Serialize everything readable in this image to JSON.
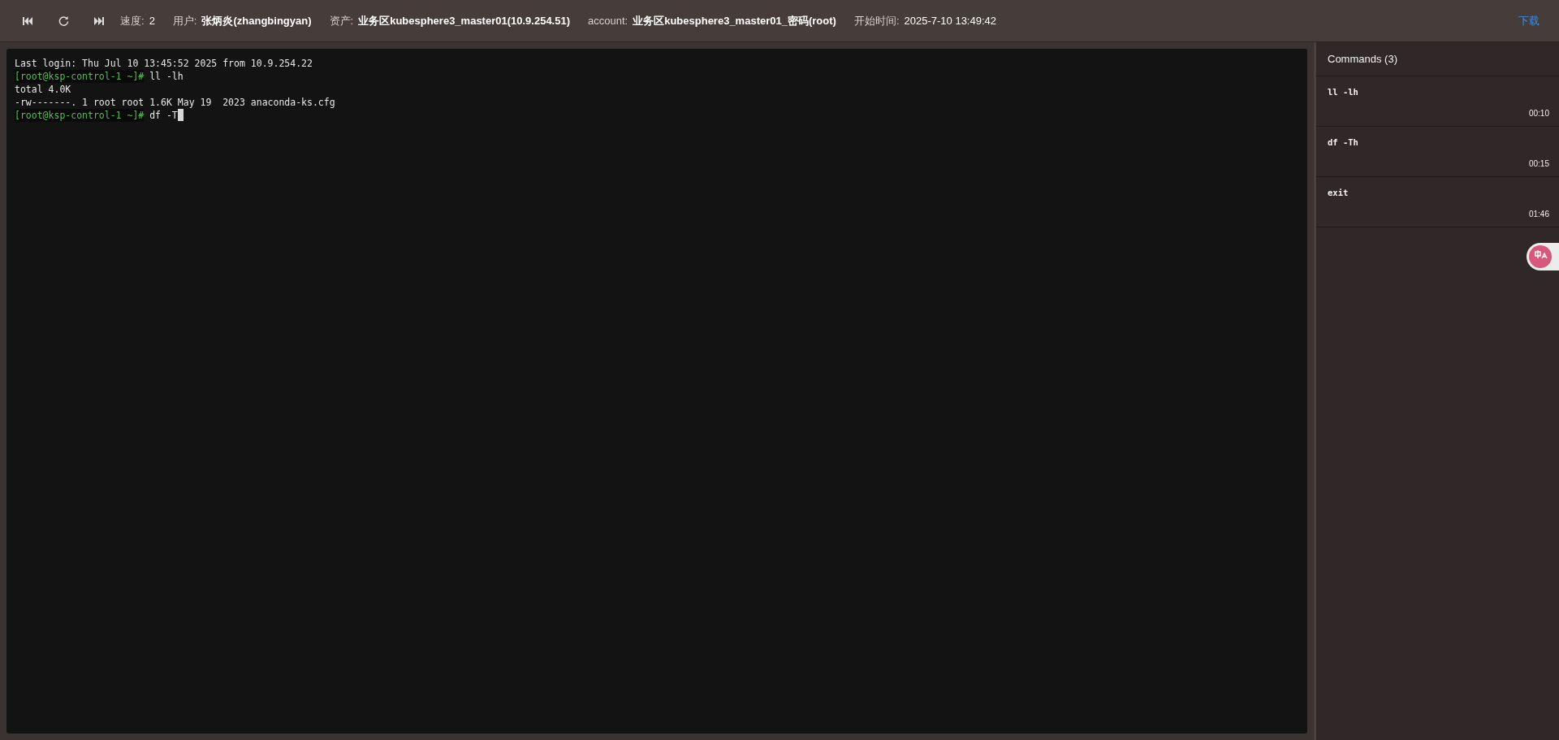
{
  "toolbar": {
    "controls": [
      {
        "kind": "skip-back"
      },
      {
        "kind": "replay"
      },
      {
        "kind": "skip-forward"
      }
    ],
    "info": [
      {
        "label": "速度:",
        "value": "2",
        "bold": false
      },
      {
        "label": "用户:",
        "value": "张炳炎(zhangbingyan)",
        "bold": true
      },
      {
        "label": "资产:",
        "value": "业务区kubesphere3_master01(10.9.254.51)",
        "bold": true
      },
      {
        "label": "account:",
        "value": "业务区kubesphere3_master01_密码(root)",
        "bold": true
      },
      {
        "label": "开始时间:",
        "value": "2025-7-10 13:49:42",
        "bold": false
      }
    ],
    "download": "下载"
  },
  "terminal": {
    "cursor": true,
    "lines": [
      [
        {
          "kind": "output",
          "text": "Last login: Thu Jul 10 13:45:52 2025 from 10.9.254.22"
        }
      ],
      [
        {
          "kind": "prompt",
          "text": "[root@ksp-control-1 ~]#"
        },
        {
          "kind": "output",
          "text": " ll -lh"
        }
      ],
      [
        {
          "kind": "output",
          "text": "total 4.0K"
        }
      ],
      [
        {
          "kind": "output",
          "text": "-rw-------. 1 root root 1.6K May 19  2023 anaconda-ks.cfg"
        }
      ],
      [
        {
          "kind": "prompt",
          "text": "[root@ksp-control-1 ~]#"
        },
        {
          "kind": "output",
          "text": " df -T"
        }
      ]
    ]
  },
  "commands": {
    "title": "Commands (3)",
    "items": [
      {
        "command": "ll -lh",
        "time": "00:10"
      },
      {
        "command": "df -Th",
        "time": "00:15"
      },
      {
        "command": "exit",
        "time": "01:46"
      }
    ]
  }
}
